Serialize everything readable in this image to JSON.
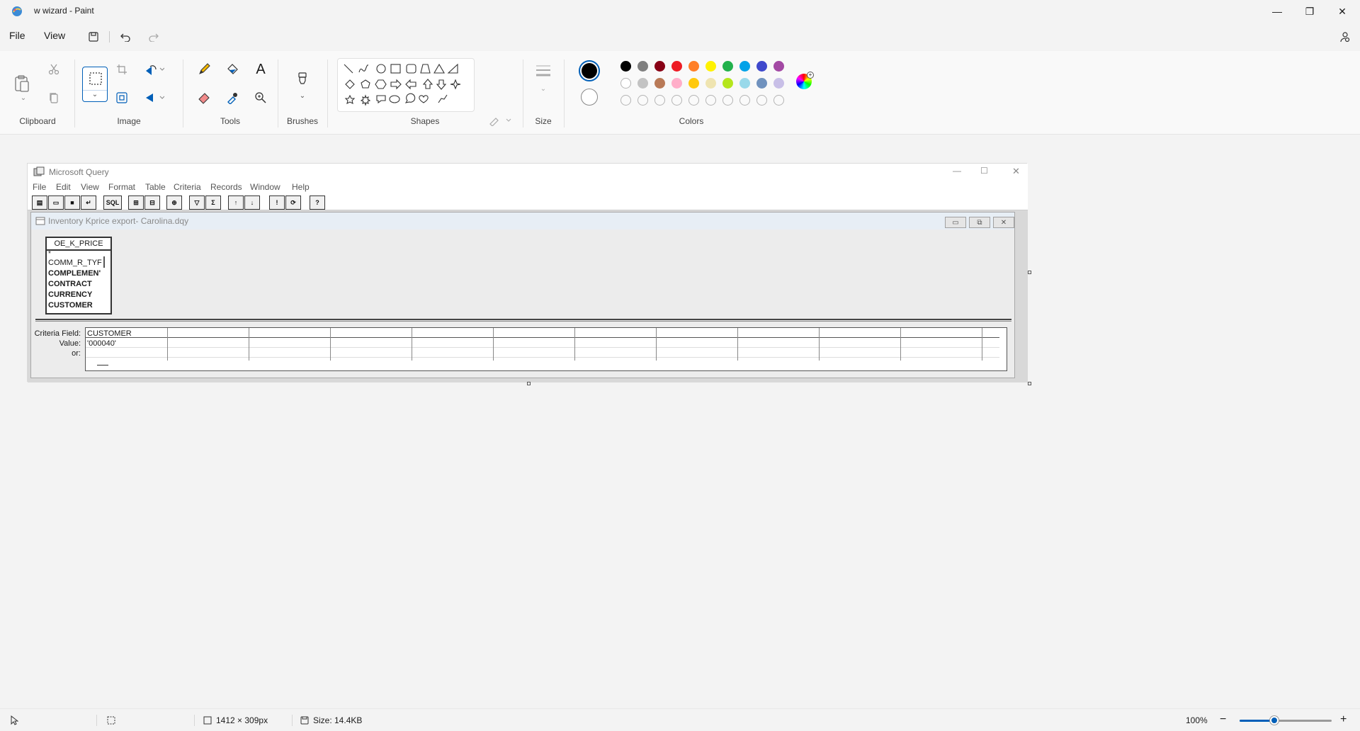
{
  "window": {
    "title": "w wizard - Paint",
    "minimize": "—",
    "maximize": "❐",
    "close": "✕"
  },
  "menu": {
    "file": "File",
    "view": "View"
  },
  "ribbon": {
    "groups": {
      "clipboard": "Clipboard",
      "image": "Image",
      "tools": "Tools",
      "brushes": "Brushes",
      "shapes": "Shapes",
      "size": "Size",
      "colors": "Colors"
    },
    "text_tool_glyph": "A",
    "colors": {
      "primary": "#000000",
      "secondary": "#ffffff",
      "palette_row1": [
        "#000000",
        "#7f7f7f",
        "#880015",
        "#ed1c24",
        "#ff7f27",
        "#fff200",
        "#22b14c",
        "#00a2e8",
        "#3f48cc",
        "#a349a4"
      ],
      "palette_row2": [
        "#ffffff",
        "#c3c3c3",
        "#b97a57",
        "#ffaec9",
        "#ffc90e",
        "#efe4b0",
        "#b5e61d",
        "#99d9ea",
        "#7092be",
        "#c8bfe7"
      ]
    }
  },
  "canvas": {
    "query_window": {
      "title": "Microsoft Query",
      "menus": [
        "File",
        "Edit",
        "View",
        "Format",
        "Table",
        "Criteria",
        "Records",
        "Window",
        "Help"
      ],
      "toolbar_sql": "SQL",
      "toolbar_sigma": "Σ",
      "toolbar_help": "?",
      "child_title": "Inventory Kprice export- Carolina.dqy",
      "table": {
        "name": "OE_K_PRICE",
        "fields": [
          "*",
          "COMM_R_TYF",
          "COMPLEMEN'",
          "CONTRACT",
          "CURRENCY",
          "CUSTOMER"
        ]
      },
      "criteria": {
        "labels": [
          "Criteria Field:",
          "Value:",
          "or:"
        ],
        "field": "CUSTOMER",
        "value": "'000040'"
      }
    }
  },
  "status": {
    "dimensions": "1412 × 309px",
    "size": "Size: 14.4KB",
    "zoom": "100%",
    "zoom_level": 0.38
  }
}
